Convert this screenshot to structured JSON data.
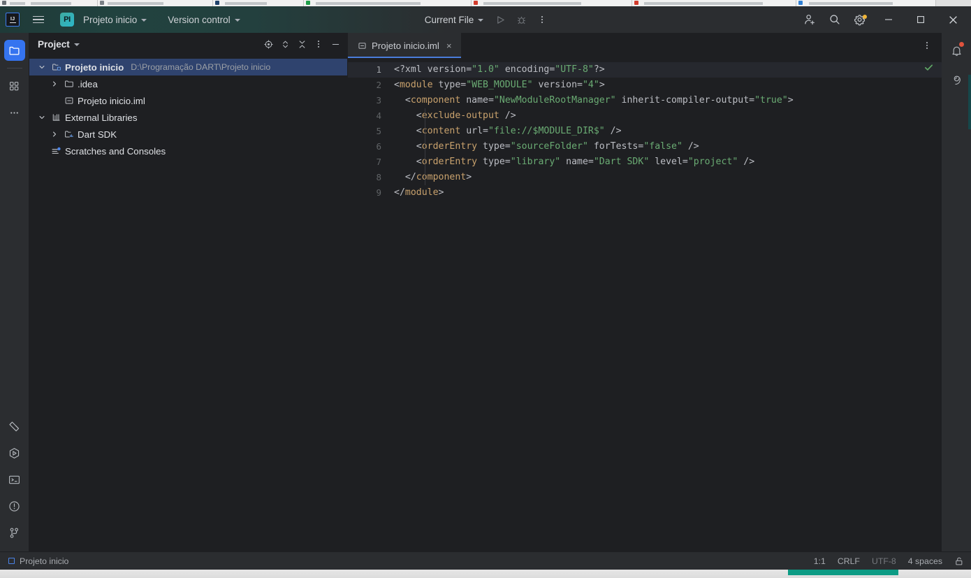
{
  "window": {
    "app": "IntelliJ IDEA",
    "logo_text": "IJ"
  },
  "toolbar": {
    "project_badge": "PI",
    "project_name": "Projeto inicio",
    "version_control": "Version control",
    "run_config": "Current File",
    "icons": {
      "menu": "hamburger-menu-icon",
      "run": "run-icon",
      "debug": "debug-icon",
      "more": "more-vertical-icon",
      "add_user": "add-user-icon",
      "search": "search-icon",
      "settings": "gear-icon"
    },
    "window_controls": {
      "minimize": "—",
      "maximize": "□",
      "close": "×"
    }
  },
  "left_stripe": {
    "items": [
      {
        "name": "project-tool-window",
        "icon": "folder-icon",
        "active": true
      },
      {
        "name": "structure-tool-window",
        "icon": "grid-squares-icon",
        "active": false
      },
      {
        "name": "more-tool-windows",
        "icon": "ellipsis-icon",
        "active": false
      }
    ],
    "bottom_items": [
      {
        "name": "dart-analysis",
        "icon": "dart-icon"
      },
      {
        "name": "run-tool-window",
        "icon": "play-hexagon-icon"
      },
      {
        "name": "terminal-tool-window",
        "icon": "terminal-icon"
      },
      {
        "name": "problems-tool-window",
        "icon": "warning-circle-icon"
      },
      {
        "name": "version-control-tool-window",
        "icon": "git-branch-icon"
      }
    ]
  },
  "project_panel": {
    "title": "Project",
    "header_icons": [
      {
        "name": "select-opened-file",
        "icon": "crosshair-icon"
      },
      {
        "name": "expand-collapse",
        "icon": "chevron-updown-icon"
      },
      {
        "name": "collapse-all",
        "icon": "collapse-all-icon"
      },
      {
        "name": "options-menu",
        "icon": "more-vertical-icon"
      },
      {
        "name": "hide-panel",
        "icon": "minimize-icon"
      }
    ],
    "tree": [
      {
        "label": "Projeto inicio",
        "path": "D:\\Programação DART\\Projeto inicio",
        "icon": "project-folder-icon",
        "indent": 0,
        "arrow": "expanded",
        "selected": true,
        "bold": true
      },
      {
        "label": ".idea",
        "path": "",
        "icon": "folder-icon",
        "indent": 1,
        "arrow": "collapsed",
        "selected": false,
        "bold": false
      },
      {
        "label": "Projeto inicio.iml",
        "path": "",
        "icon": "iml-file-icon",
        "indent": 1,
        "arrow": "none",
        "selected": false,
        "bold": false
      },
      {
        "label": "External Libraries",
        "path": "",
        "icon": "library-icon",
        "indent": 0,
        "arrow": "expanded",
        "selected": false,
        "bold": false
      },
      {
        "label": "Dart SDK",
        "path": "",
        "icon": "sdk-folder-icon",
        "indent": 1,
        "arrow": "collapsed",
        "selected": false,
        "bold": false
      },
      {
        "label": "Scratches and Consoles",
        "path": "",
        "icon": "scratches-icon",
        "indent": 0,
        "arrow": "none",
        "selected": false,
        "bold": false
      }
    ]
  },
  "editor": {
    "tabs": [
      {
        "label": "Projeto inicio.iml",
        "icon": "iml-file-icon",
        "active": true,
        "close": "×"
      }
    ],
    "tab_options_icon": "more-vertical-icon",
    "inspection_status": "ok-checkmark-icon",
    "current_line": 1,
    "lines": [
      {
        "n": 1,
        "tokens": [
          {
            "t": "punc",
            "v": "<?xml "
          },
          {
            "t": "attr",
            "v": "version="
          },
          {
            "t": "val",
            "v": "\"1.0\""
          },
          {
            "t": "attr",
            "v": " encoding="
          },
          {
            "t": "val",
            "v": "\"UTF-8\""
          },
          {
            "t": "punc",
            "v": "?>"
          }
        ]
      },
      {
        "n": 2,
        "tokens": [
          {
            "t": "punc",
            "v": "<"
          },
          {
            "t": "tag",
            "v": "module"
          },
          {
            "t": "attr",
            "v": " type="
          },
          {
            "t": "val",
            "v": "\"WEB_MODULE\""
          },
          {
            "t": "attr",
            "v": " version="
          },
          {
            "t": "val",
            "v": "\"4\""
          },
          {
            "t": "punc",
            "v": ">"
          }
        ]
      },
      {
        "n": 3,
        "tokens": [
          {
            "t": "punc",
            "v": "  <"
          },
          {
            "t": "tag",
            "v": "component"
          },
          {
            "t": "attr",
            "v": " name="
          },
          {
            "t": "val",
            "v": "\"NewModuleRootManager\""
          },
          {
            "t": "attr",
            "v": " inherit-compiler-output="
          },
          {
            "t": "val",
            "v": "\"true\""
          },
          {
            "t": "punc",
            "v": ">"
          }
        ]
      },
      {
        "n": 4,
        "tokens": [
          {
            "t": "punc",
            "v": "    <"
          },
          {
            "t": "tag",
            "v": "exclude-output"
          },
          {
            "t": "punc",
            "v": " />"
          }
        ]
      },
      {
        "n": 5,
        "tokens": [
          {
            "t": "punc",
            "v": "    <"
          },
          {
            "t": "tag",
            "v": "content"
          },
          {
            "t": "attr",
            "v": " url="
          },
          {
            "t": "val",
            "v": "\"file://$MODULE_DIR$\""
          },
          {
            "t": "punc",
            "v": " />"
          }
        ]
      },
      {
        "n": 6,
        "tokens": [
          {
            "t": "punc",
            "v": "    <"
          },
          {
            "t": "tag",
            "v": "orderEntry"
          },
          {
            "t": "attr",
            "v": " type="
          },
          {
            "t": "val",
            "v": "\"sourceFolder\""
          },
          {
            "t": "attr",
            "v": " forTests="
          },
          {
            "t": "val",
            "v": "\"false\""
          },
          {
            "t": "punc",
            "v": " />"
          }
        ]
      },
      {
        "n": 7,
        "tokens": [
          {
            "t": "punc",
            "v": "    <"
          },
          {
            "t": "tag",
            "v": "orderEntry"
          },
          {
            "t": "attr",
            "v": " type="
          },
          {
            "t": "val",
            "v": "\"library\""
          },
          {
            "t": "attr",
            "v": " name="
          },
          {
            "t": "val",
            "v": "\"Dart SDK\""
          },
          {
            "t": "attr",
            "v": " level="
          },
          {
            "t": "val",
            "v": "\"project\""
          },
          {
            "t": "punc",
            "v": " />"
          }
        ]
      },
      {
        "n": 8,
        "tokens": [
          {
            "t": "punc",
            "v": "  </"
          },
          {
            "t": "tag",
            "v": "component"
          },
          {
            "t": "punc",
            "v": ">"
          }
        ]
      },
      {
        "n": 9,
        "tokens": [
          {
            "t": "punc",
            "v": "</"
          },
          {
            "t": "tag",
            "v": "module"
          },
          {
            "t": "punc",
            "v": ">"
          }
        ]
      }
    ]
  },
  "right_stripe": {
    "items": [
      {
        "name": "notifications",
        "icon": "bell-icon",
        "badge": true
      },
      {
        "name": "ai-assistant",
        "icon": "spiral-icon",
        "badge": false
      }
    ]
  },
  "status_bar": {
    "project": "Projeto inicio",
    "caret": "1:1",
    "line_separator": "CRLF",
    "encoding": "UTF-8",
    "indent": "4 spaces",
    "lock_icon": "unlocked-icon"
  },
  "colors": {
    "accent_blue": "#3574f0",
    "selection": "#2f436e",
    "toolbar_teal": "#21423f",
    "tag": "#c9a26d",
    "value": "#6aab73",
    "notification": "#e0533d",
    "settings_dot": "#f0b537",
    "taskbar_item": "#0d9c85"
  }
}
